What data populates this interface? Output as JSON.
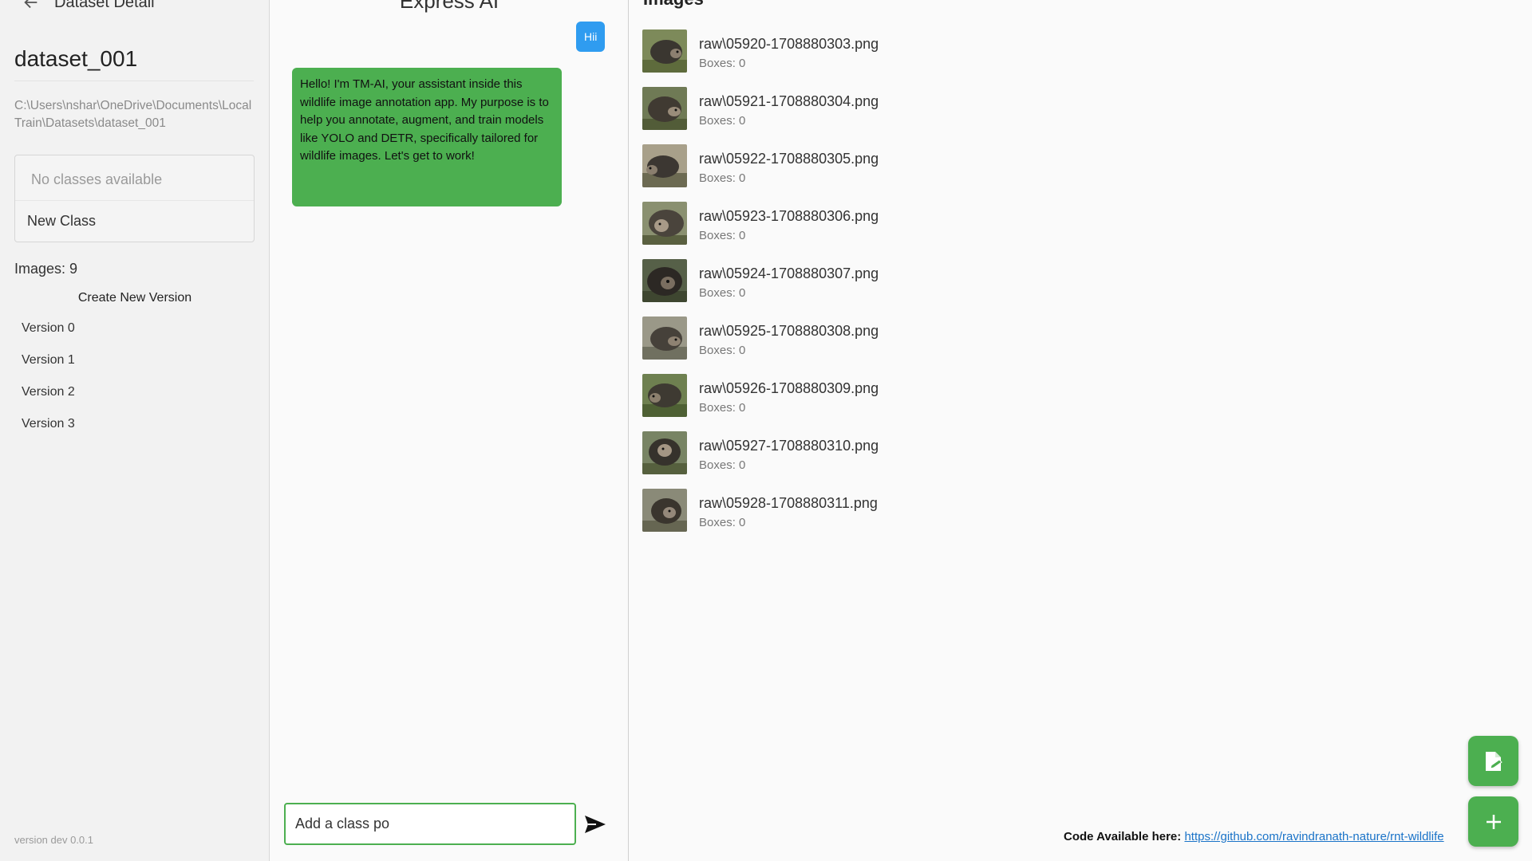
{
  "sidebar": {
    "header_title": "Dataset Detail",
    "dataset_name": "dataset_001",
    "dataset_path": "C:\\Users\\nshar\\OneDrive\\Documents\\LocalTrain\\Datasets\\dataset_001",
    "no_classes_text": "No classes available",
    "new_class_label": "New Class",
    "images_count": "Images: 9",
    "create_version_label": "Create New Version",
    "versions": [
      "Version 0",
      "Version 1",
      "Version 2",
      "Version 3"
    ],
    "app_version": "version dev 0.0.1"
  },
  "chat": {
    "title": "Express AI",
    "user_message": "Hii",
    "ai_message": "Hello! I'm TM-AI, your assistant inside this wildlife image annotation app. My purpose is to help you annotate, augment, and train models like YOLO and DETR, specifically tailored for wildlife images. Let's get to work!",
    "input_value": "Add a class po",
    "send_icon": "send-icon"
  },
  "images": {
    "heading": "Images",
    "items": [
      {
        "name": "raw\\05920-1708880303.png",
        "boxes": "Boxes: 0"
      },
      {
        "name": "raw\\05921-1708880304.png",
        "boxes": "Boxes: 0"
      },
      {
        "name": "raw\\05922-1708880305.png",
        "boxes": "Boxes: 0"
      },
      {
        "name": "raw\\05923-1708880306.png",
        "boxes": "Boxes: 0"
      },
      {
        "name": "raw\\05924-1708880307.png",
        "boxes": "Boxes: 0"
      },
      {
        "name": "raw\\05925-1708880308.png",
        "boxes": "Boxes: 0"
      },
      {
        "name": "raw\\05926-1708880309.png",
        "boxes": "Boxes: 0"
      },
      {
        "name": "raw\\05927-1708880310.png",
        "boxes": "Boxes: 0"
      },
      {
        "name": "raw\\05928-1708880311.png",
        "boxes": "Boxes: 0"
      }
    ]
  },
  "footer": {
    "label": "Code Available here:",
    "link": "https://github.com/ravindranath-nature/rnt-wildlife"
  },
  "colors": {
    "accent_green": "#4caf50",
    "user_bubble_blue": "#2f9cf0",
    "link_blue": "#1a73c8"
  }
}
